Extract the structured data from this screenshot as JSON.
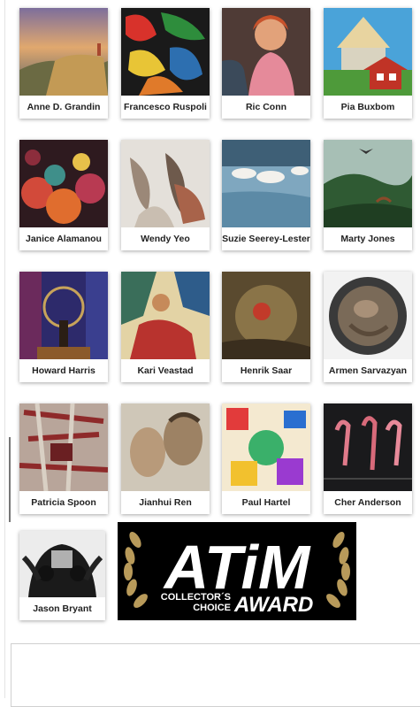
{
  "artists": [
    {
      "name": "Anne D. Grandin"
    },
    {
      "name": "Francesco Ruspoli"
    },
    {
      "name": "Ric Conn"
    },
    {
      "name": "Pia Buxbom"
    },
    {
      "name": "Janice Alamanou"
    },
    {
      "name": "Wendy Yeo"
    },
    {
      "name": "Suzie Seerey-Lester"
    },
    {
      "name": "Marty Jones"
    },
    {
      "name": "Howard Harris"
    },
    {
      "name": "Kari Veastad"
    },
    {
      "name": "Henrik Saar"
    },
    {
      "name": "Armen Sarvazyan"
    },
    {
      "name": "Patricia Spoon"
    },
    {
      "name": "Jianhui Ren"
    },
    {
      "name": "Paul Hartel"
    },
    {
      "name": "Cher Anderson"
    },
    {
      "name": "Jason Bryant"
    }
  ],
  "award": {
    "logo_text": "ATiM",
    "line1": "COLLECTOR´S",
    "line2": "CHOICE",
    "award_word": "AWARD"
  },
  "colors": {
    "award_bg": "#000000",
    "laurel": "#b89a5a"
  }
}
